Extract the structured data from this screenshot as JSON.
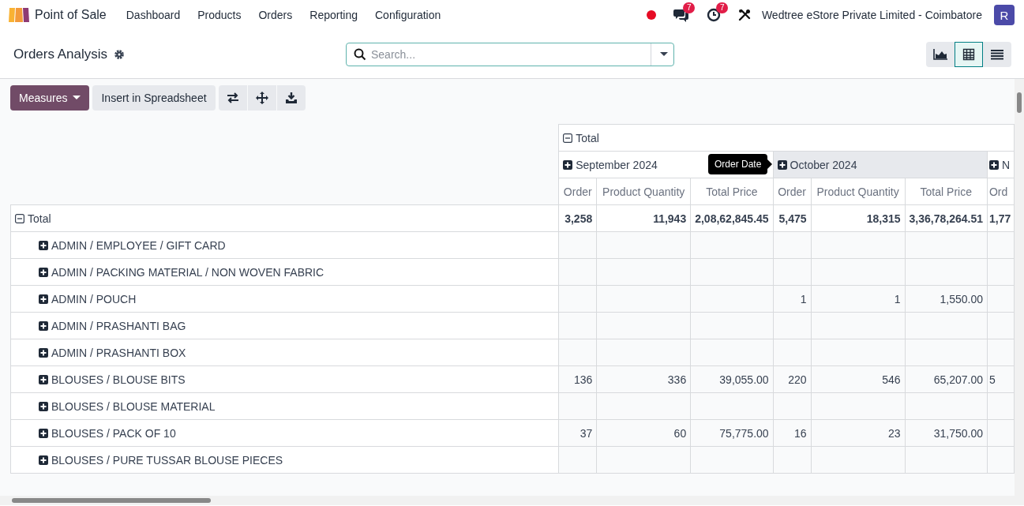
{
  "navbar": {
    "app_name": "Point of Sale",
    "menu": [
      "Dashboard",
      "Products",
      "Orders",
      "Reporting",
      "Configuration"
    ],
    "messages_badge": "7",
    "activities_badge": "7",
    "company": "Wedtree eStore Private Limited - Coimbatore",
    "avatar": "R"
  },
  "control_panel": {
    "title": "Orders Analysis",
    "search": {
      "placeholder": "Search..."
    },
    "views": [
      {
        "kind": "graph",
        "selected": false
      },
      {
        "kind": "pivot",
        "selected": true
      },
      {
        "kind": "list",
        "selected": false
      }
    ]
  },
  "toolbar": {
    "measures": "Measures",
    "insert": "Insert in Spreadsheet",
    "actions": [
      {
        "kind": "flip"
      },
      {
        "kind": "expand"
      },
      {
        "kind": "download"
      }
    ]
  },
  "pivot": {
    "column_total": {
      "label": "Total",
      "expanded": true
    },
    "column_groups": [
      {
        "label": "September 2024",
        "expanded": false,
        "hovered": false
      },
      {
        "label": "October 2024",
        "expanded": false,
        "hovered": true
      },
      {
        "label": "N",
        "expanded": false,
        "hovered": false
      }
    ],
    "measures": [
      "Order",
      "Product Quantity",
      "Total Price",
      "Order",
      "Product Quantity",
      "Total Price",
      "Ord"
    ],
    "tooltip": "Order Date",
    "rows": [
      {
        "label": "Total",
        "expanded": true,
        "cells": [
          "3,258",
          "11,943",
          "2,08,62,845.45",
          "5,475",
          "18,315",
          "3,36,78,264.51",
          "1,77"
        ],
        "children": [
          {
            "label": "ADMIN / EMPLOYEE / GIFT CARD",
            "expanded": false,
            "cells": [
              null,
              null,
              null,
              null,
              null,
              null,
              null
            ]
          },
          {
            "label": "ADMIN / PACKING MATERIAL / NON WOVEN FABRIC",
            "expanded": false,
            "cells": [
              null,
              null,
              null,
              null,
              null,
              null,
              null
            ]
          },
          {
            "label": "ADMIN / POUCH",
            "expanded": false,
            "cells": [
              null,
              null,
              null,
              "1",
              "1",
              "1,550.00",
              null
            ]
          },
          {
            "label": "ADMIN / PRASHANTI BAG",
            "expanded": false,
            "cells": [
              null,
              null,
              null,
              null,
              null,
              null,
              null
            ]
          },
          {
            "label": "ADMIN / PRASHANTI BOX",
            "expanded": false,
            "cells": [
              null,
              null,
              null,
              null,
              null,
              null,
              null
            ]
          },
          {
            "label": "BLOUSES / BLOUSE BITS",
            "expanded": false,
            "cells": [
              "136",
              "336",
              "39,055.00",
              "220",
              "546",
              "65,207.00",
              "5"
            ]
          },
          {
            "label": "BLOUSES / BLOUSE MATERIAL",
            "expanded": false,
            "cells": [
              null,
              null,
              null,
              null,
              null,
              null,
              null
            ]
          },
          {
            "label": "BLOUSES / PACK OF 10",
            "expanded": false,
            "cells": [
              "37",
              "60",
              "75,775.00",
              "16",
              "23",
              "31,750.00",
              null
            ]
          },
          {
            "label": "BLOUSES / PURE TUSSAR BLOUSE PIECES",
            "expanded": false,
            "cells": [
              null,
              null,
              null,
              null,
              null,
              null,
              null
            ]
          }
        ]
      }
    ]
  }
}
